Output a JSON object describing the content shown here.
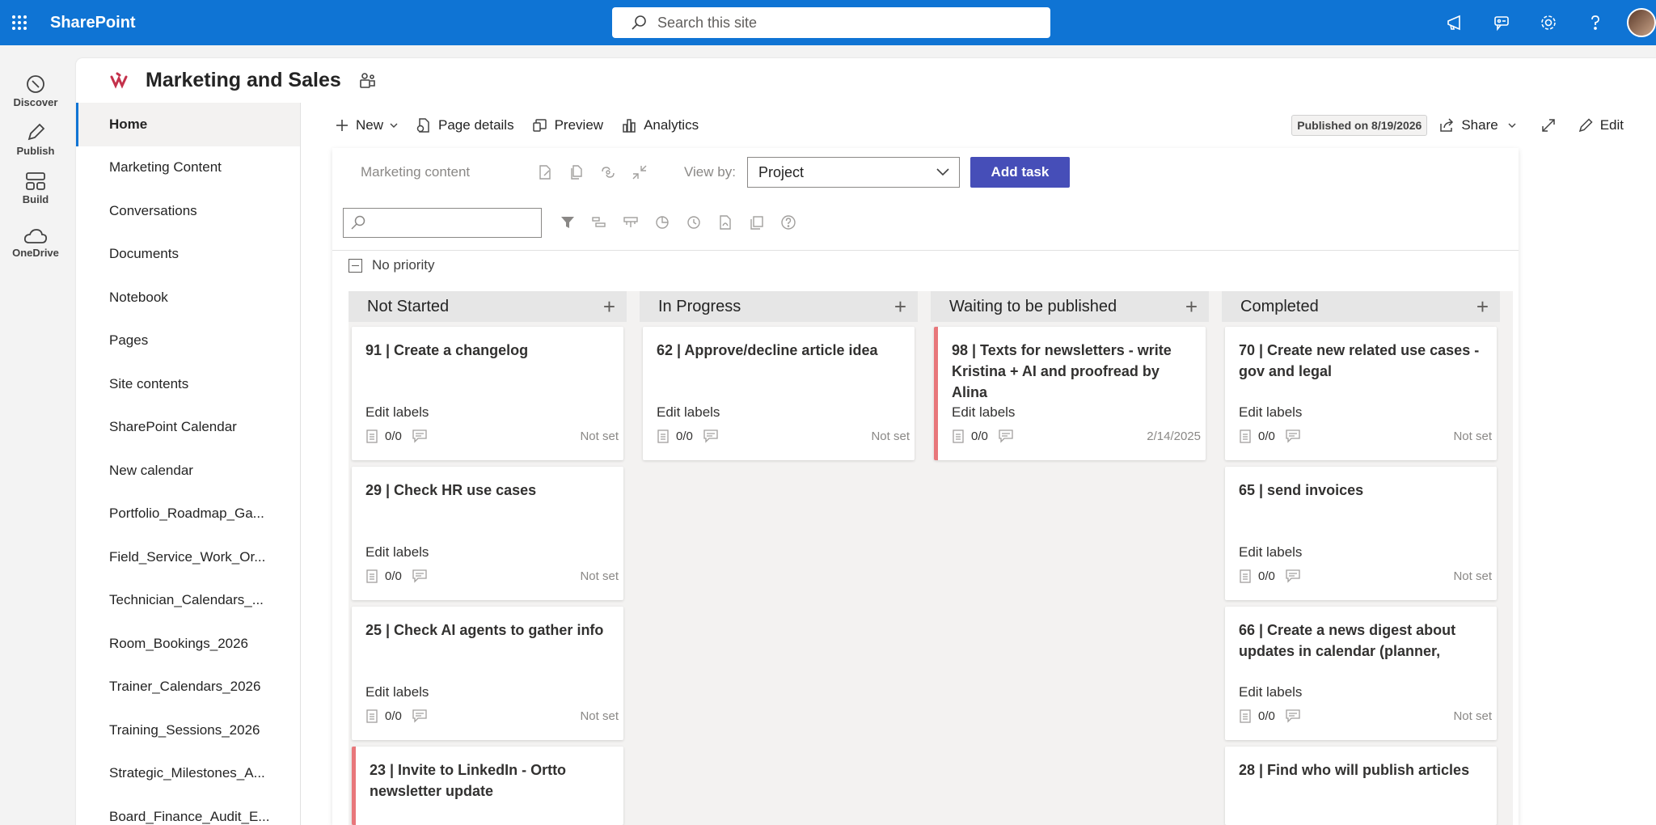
{
  "suite": {
    "brand": "SharePoint",
    "search_placeholder": "Search this site"
  },
  "appbar": [
    {
      "label": "Discover",
      "icon": "discover-icon"
    },
    {
      "label": "Publish",
      "icon": "pen-icon"
    },
    {
      "label": "Build",
      "icon": "build-icon"
    },
    {
      "label": "OneDrive",
      "icon": "cloud-icon"
    }
  ],
  "site": {
    "title": "Marketing and Sales",
    "accent": "#c4314b"
  },
  "nav": [
    "Home",
    "Marketing Content",
    "Conversations",
    "Documents",
    "Notebook",
    "Pages",
    "Site contents",
    "SharePoint Calendar",
    "New calendar",
    "Portfolio_Roadmap_Ga...",
    "Field_Service_Work_Or...",
    "Technician_Calendars_...",
    "Room_Bookings_2026",
    "Trainer_Calendars_2026",
    "Training_Sessions_2026",
    "Strategic_Milestones_A...",
    "Board_Finance_Audit_E..."
  ],
  "command": {
    "new": "New",
    "page_details": "Page details",
    "preview": "Preview",
    "analytics": "Analytics",
    "published": "Published on 8/19/2026",
    "share": "Share",
    "edit": "Edit"
  },
  "planner": {
    "plan_name": "Marketing content",
    "view_by_label": "View by:",
    "view_by_value": "Project",
    "add_task": "Add task",
    "priority_group": "No priority",
    "columns": [
      {
        "title": "Not Started",
        "cards": [
          {
            "title": "91 | Create a changelog",
            "labels": "Edit labels",
            "count": "0/0",
            "due": "Not set",
            "urgent": false
          },
          {
            "title": "29 | Check HR use cases",
            "labels": "Edit labels",
            "count": "0/0",
            "due": "Not set",
            "urgent": false
          },
          {
            "title": "25 | Check AI agents to gather info",
            "labels": "Edit labels",
            "count": "0/0",
            "due": "Not set",
            "urgent": false
          },
          {
            "title": "23 | Invite to LinkedIn - Ortto newsletter update",
            "labels": "",
            "count": "",
            "due": "",
            "urgent": true
          }
        ]
      },
      {
        "title": "In Progress",
        "cards": [
          {
            "title": "62 | Approve/decline article idea",
            "labels": "Edit labels",
            "count": "0/0",
            "due": "Not set",
            "urgent": false
          }
        ]
      },
      {
        "title": "Waiting to be published",
        "cards": [
          {
            "title": "98 | Texts for newsletters - write Kristina + AI and proofread by Alina",
            "labels": "Edit labels",
            "count": "0/0",
            "due": "2/14/2025",
            "urgent": true
          }
        ]
      },
      {
        "title": "Completed",
        "cards": [
          {
            "title": "70 | Create new related use cases - gov and legal",
            "labels": "Edit labels",
            "count": "0/0",
            "due": "Not set",
            "urgent": false
          },
          {
            "title": "65 | send invoices",
            "labels": "Edit labels",
            "count": "0/0",
            "due": "Not set",
            "urgent": false
          },
          {
            "title": "66 | Create a news digest about updates in calendar (planner,",
            "labels": "Edit labels",
            "count": "0/0",
            "due": "Not set",
            "urgent": false
          },
          {
            "title": "28 | Find who will publish articles",
            "labels": "",
            "count": "",
            "due": "",
            "urgent": false
          }
        ]
      }
    ]
  }
}
